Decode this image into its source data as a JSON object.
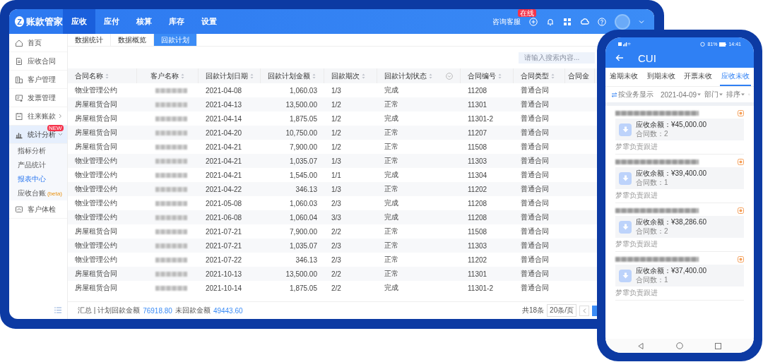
{
  "tablet": {
    "logo": {
      "mark": "Z",
      "name": "账款管家"
    },
    "nav": [
      {
        "label": "应收",
        "selected": true
      },
      {
        "label": "应付",
        "selected": false
      },
      {
        "label": "核算",
        "selected": false
      },
      {
        "label": "库存",
        "selected": false
      },
      {
        "label": "设置",
        "selected": false
      }
    ],
    "support": {
      "label": "咨询客服",
      "badge": "在线"
    },
    "sidebar": {
      "items": [
        {
          "kind": "link",
          "label": "首页",
          "selected": false
        },
        {
          "kind": "link",
          "label": "应收合同",
          "selected": false
        },
        {
          "kind": "link",
          "label": "客户管理",
          "selected": false
        },
        {
          "kind": "link",
          "label": "发票管理",
          "selected": false
        },
        {
          "kind": "group",
          "label": "往来账款",
          "selected": false,
          "expanded": false
        },
        {
          "kind": "group",
          "label": "统计分析",
          "badge": "NEW",
          "selected": true,
          "expanded": true,
          "children": [
            {
              "label": "指标分析",
              "selected": false
            },
            {
              "label": "产品统计",
              "selected": false
            },
            {
              "label": "报表中心",
              "selected": true
            },
            {
              "label": "应收台账",
              "tag": "(beta)",
              "selected": false
            }
          ]
        },
        {
          "kind": "link",
          "label": "客户体检",
          "selected": false
        }
      ]
    },
    "subtabs": [
      {
        "label": "数据统计",
        "selected": false
      },
      {
        "label": "数据概览",
        "selected": false
      },
      {
        "label": "回款计划",
        "selected": true
      }
    ],
    "search": {
      "placeholder": "请输入搜索内容..."
    },
    "table": {
      "columns": [
        {
          "label": "合同名称",
          "kind": "text",
          "sortable": true
        },
        {
          "label": "客户名称",
          "kind": "redacted",
          "sortable": true
        },
        {
          "label": "回款计划日期",
          "kind": "text",
          "sortable": true
        },
        {
          "label": "回款计划金额",
          "kind": "number",
          "sortable": true
        },
        {
          "label": "回款期次",
          "kind": "text",
          "sortable": true
        },
        {
          "label": "回款计划状态",
          "kind": "text",
          "sortable": true,
          "filter": true
        },
        {
          "label": "合同编号",
          "kind": "text",
          "sortable": true
        },
        {
          "label": "合同类型",
          "kind": "text",
          "sortable": true
        },
        {
          "label": "合同金",
          "kind": "text"
        }
      ],
      "rows": [
        [
          "物业管理公约",
          "",
          "2021-04-08",
          "1,060.03",
          "1/3",
          "完成",
          "11208",
          "普通合同"
        ],
        [
          "房屋租赁合同",
          "",
          "2021-04-13",
          "13,500.00",
          "1/2",
          "正常",
          "11301",
          "普通合同"
        ],
        [
          "房屋租赁合同",
          "",
          "2021-04-14",
          "1,875.05",
          "1/2",
          "完成",
          "11301-2",
          "普通合同"
        ],
        [
          "房屋租赁合同",
          "",
          "2021-04-20",
          "10,750.00",
          "1/2",
          "正常",
          "11207",
          "普通合同"
        ],
        [
          "房屋租赁合同",
          "",
          "2021-04-21",
          "7,900.00",
          "1/2",
          "正常",
          "11508",
          "普通合同"
        ],
        [
          "物业管理公约",
          "",
          "2021-04-21",
          "1,035.07",
          "1/3",
          "正常",
          "11303",
          "普通合同"
        ],
        [
          "物业管理公约",
          "",
          "2021-04-21",
          "1,545.00",
          "1/1",
          "完成",
          "11304",
          "普通合同"
        ],
        [
          "物业管理公约",
          "",
          "2021-04-22",
          "346.13",
          "1/3",
          "正常",
          "11202",
          "普通合同"
        ],
        [
          "物业管理公约",
          "",
          "2021-05-08",
          "1,060.03",
          "2/3",
          "完成",
          "11208",
          "普通合同"
        ],
        [
          "物业管理公约",
          "",
          "2021-06-08",
          "1,060.04",
          "3/3",
          "完成",
          "11208",
          "普通合同"
        ],
        [
          "房屋租赁合同",
          "",
          "2021-07-21",
          "7,900.00",
          "2/2",
          "正常",
          "11508",
          "普通合同"
        ],
        [
          "物业管理公约",
          "",
          "2021-07-21",
          "1,035.07",
          "2/3",
          "正常",
          "11303",
          "普通合同"
        ],
        [
          "物业管理公约",
          "",
          "2021-07-22",
          "346.13",
          "2/3",
          "正常",
          "11202",
          "普通合同"
        ],
        [
          "房屋租赁合同",
          "",
          "2021-10-13",
          "13,500.00",
          "2/2",
          "正常",
          "11301",
          "普通合同"
        ],
        [
          "房屋租赁合同",
          "",
          "2021-10-14",
          "1,875.05",
          "2/2",
          "完成",
          "11301-2",
          "普通合同"
        ]
      ]
    },
    "footer": {
      "summary_label": "汇总 | 计划回款金额",
      "planned": "76918.80",
      "unpaid_label": "未回款金额",
      "unpaid": "49443.60",
      "total": "共18条",
      "page_size": "20条/页"
    }
  },
  "phone": {
    "status_bar": {
      "battery": "81%",
      "time": "14:41"
    },
    "title": "CUI",
    "tabs": [
      {
        "label": "逾期未收",
        "selected": false
      },
      {
        "label": "到期未收",
        "selected": false
      },
      {
        "label": "开票未收",
        "selected": false
      },
      {
        "label": "应收未收",
        "selected": true
      }
    ],
    "filters": {
      "group_by": "按业务显示",
      "date": "2021-04-09",
      "department": "部门",
      "sort": "排序"
    },
    "cards": [
      {
        "amount": "应收余额：¥45,000.00",
        "contracts": "合同数：2",
        "owner": "梦霏负责跟进"
      },
      {
        "amount": "应收余额：¥39,400.00",
        "contracts": "合同数：1",
        "owner": "梦霏负责跟进"
      },
      {
        "amount": "应收余额：¥38,286.60",
        "contracts": "合同数：2",
        "owner": "梦霏负责跟进"
      },
      {
        "amount": "应收余额：¥37,400.00",
        "contracts": "合同数：1",
        "owner": "梦霏负责跟进"
      }
    ]
  }
}
